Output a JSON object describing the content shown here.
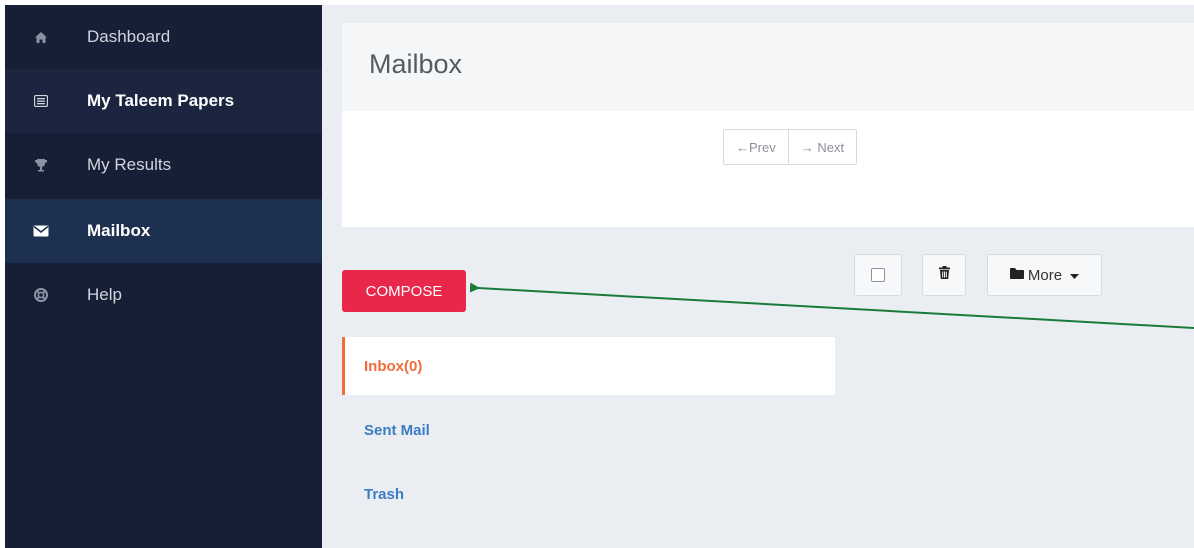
{
  "sidebar": {
    "items": [
      {
        "label": "Dashboard",
        "icon": "home-icon"
      },
      {
        "label": "My Taleem Papers",
        "icon": "list-icon"
      },
      {
        "label": "My Results",
        "icon": "trophy-icon"
      },
      {
        "label": "Mailbox",
        "icon": "envelope-icon"
      },
      {
        "label": "Help",
        "icon": "lifebuoy-icon"
      }
    ]
  },
  "header": {
    "title": "Mailbox"
  },
  "pager": {
    "prev": "←Prev",
    "next": "→ Next"
  },
  "compose": {
    "label": "COMPOSE"
  },
  "toolbar": {
    "more_label": "More"
  },
  "folders": [
    {
      "label": "Inbox(0)",
      "active": true
    },
    {
      "label": "Sent Mail",
      "active": false
    },
    {
      "label": "Trash",
      "active": false
    }
  ],
  "colors": {
    "sidebar_bg": "#161f35",
    "compose_bg": "#e8274a",
    "folder_active": "#f26b3a",
    "folder_link": "#3b7dc4",
    "annotation_arrow": "#1b7a3a"
  }
}
